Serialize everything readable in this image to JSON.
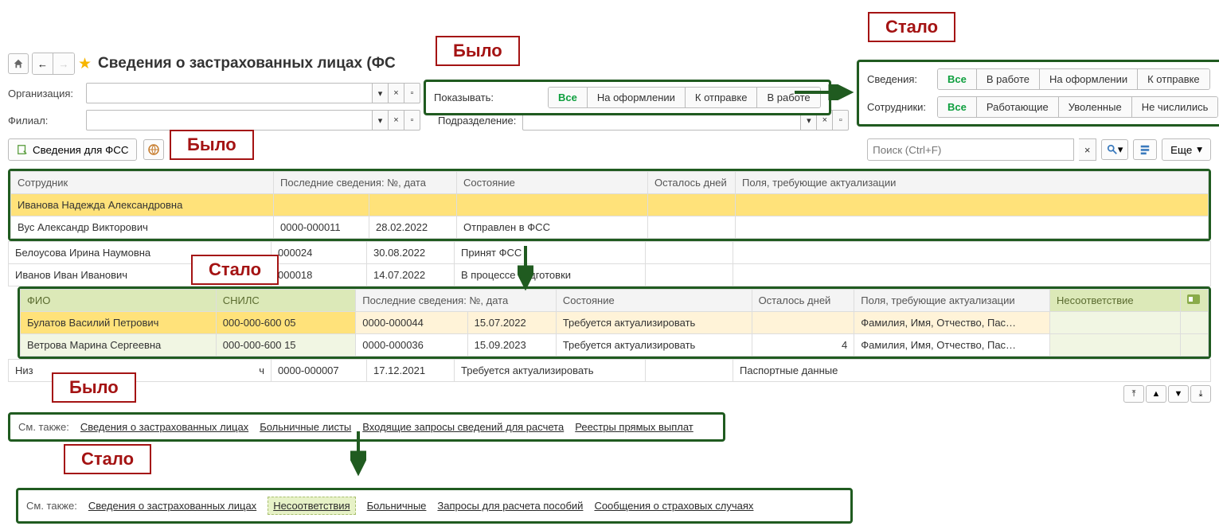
{
  "annotations": {
    "was": "Было",
    "became": "Стало"
  },
  "header": {
    "title": "Сведения о застрахованных лицах (ФС"
  },
  "filters": {
    "org_label": "Организация:",
    "branch_label": "Филиал:",
    "dept_label": "Подразделение:",
    "show_label": "Показывать:"
  },
  "seg_old": [
    "Все",
    "На оформлении",
    "К отправке",
    "В работе"
  ],
  "seg_new": {
    "row1_label": "Сведения:",
    "row1": [
      "Все",
      "В работе",
      "На оформлении",
      "К отправке"
    ],
    "row2_label": "Сотрудники:",
    "row2": [
      "Все",
      "Работающие",
      "Уволенные",
      "Не числились"
    ]
  },
  "toolbar": {
    "fss_btn": "Сведения для ФСС",
    "more_btn": "Еще",
    "search_placeholder": "Поиск (Ctrl+F)"
  },
  "table_old": {
    "headers": [
      "Сотрудник",
      "Последние сведения: №, дата",
      "",
      "Состояние",
      "Осталось дней",
      "Поля, требующие актуализации"
    ],
    "rows": [
      {
        "emp": "Иванова Надежда Александровна",
        "num": "",
        "date": "",
        "state": "",
        "days": "",
        "fields": "",
        "sel": true
      },
      {
        "emp": "Вус Александр Викторович",
        "num": "0000-000011",
        "date": "28.02.2022",
        "state": "Отправлен в ФСС",
        "days": "",
        "fields": ""
      }
    ]
  },
  "table_mid": {
    "rows": [
      {
        "emp": "Белоусова Ирина Наумовна",
        "num": "000024",
        "date": "30.08.2022",
        "state": "Принят ФСС",
        "days": "",
        "fields": ""
      },
      {
        "emp": "Иванов Иван Иванович",
        "num": "000018",
        "date": "14.07.2022",
        "state": "В процессе подготовки",
        "days": "",
        "fields": ""
      }
    ]
  },
  "table_new": {
    "headers": [
      "ФИО",
      "СНИЛС",
      "Последние сведения: №, дата",
      "",
      "Состояние",
      "Осталось дней",
      "Поля, требующие актуализации",
      "Несоответствие",
      ""
    ],
    "rows": [
      {
        "fio": "Булатов Василий Петрович",
        "snils": "000-000-600 05",
        "num": "0000-000044",
        "date": "15.07.2022",
        "state": "Требуется актуализировать",
        "days": "",
        "fields": "Фамилия, Имя, Отчество, Пас…",
        "mis": ""
      },
      {
        "fio": "Ветрова Марина Сергеевна",
        "snils": "000-000-600 15",
        "num": "0000-000036",
        "date": "15.09.2023",
        "state": "Требуется актуализировать",
        "days": "4",
        "fields": "Фамилия, Имя, Отчество, Пас…",
        "mis": ""
      }
    ]
  },
  "table_tail": {
    "rows": [
      {
        "emp": "Низ",
        "tail": "ч",
        "num": "0000-000007",
        "date": "17.12.2021",
        "state": "Требуется актуализировать",
        "days": "",
        "fields": "Паспортные данные"
      }
    ]
  },
  "links_old": {
    "label": "См. также:",
    "items": [
      "Сведения о застрахованных лицах",
      "Больничные листы",
      "Входящие запросы сведений для расчета",
      "Реестры прямых выплат"
    ]
  },
  "links_new": {
    "label": "См. также:",
    "items": [
      "Сведения о застрахованных лицах",
      "Несоответствия",
      "Больничные",
      "Запросы для расчета пособий",
      "Сообщения о страховых случаях"
    ]
  }
}
